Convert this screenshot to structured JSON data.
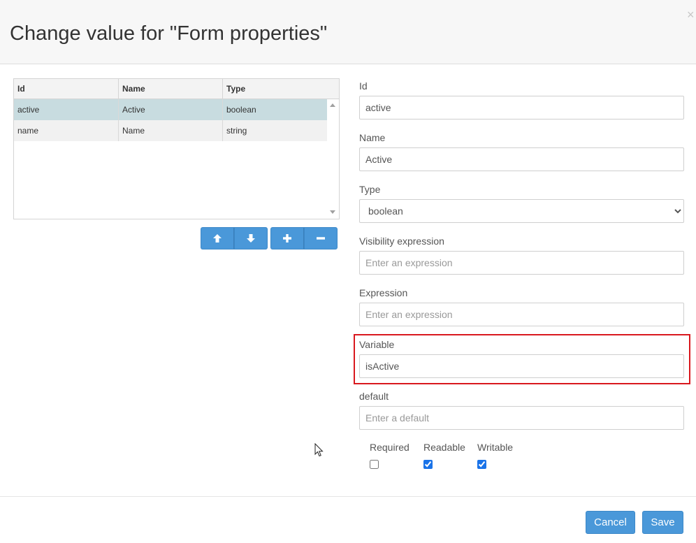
{
  "dialog": {
    "title": "Change value for \"Form properties\"",
    "close_glyph": "×"
  },
  "grid": {
    "columns": [
      "Id",
      "Name",
      "Type"
    ],
    "rows": [
      {
        "id": "active",
        "name": "Active",
        "type": "boolean",
        "selected": true
      },
      {
        "id": "name",
        "name": "Name",
        "type": "string",
        "selected": false
      }
    ]
  },
  "actions": {
    "move_up_icon": "arrow-up-icon",
    "move_down_icon": "arrow-down-icon",
    "add_icon": "plus-icon",
    "remove_icon": "minus-icon"
  },
  "form": {
    "id_label": "Id",
    "id_value": "active",
    "name_label": "Name",
    "name_value": "Active",
    "type_label": "Type",
    "type_value": "boolean",
    "visibility_label": "Visibility expression",
    "visibility_placeholder": "Enter an expression",
    "expression_label": "Expression",
    "expression_placeholder": "Enter an expression",
    "variable_label": "Variable",
    "variable_value": "isActive",
    "default_label": "default",
    "default_placeholder": "Enter a default",
    "required_label": "Required",
    "required_checked": false,
    "readable_label": "Readable",
    "readable_checked": true,
    "writable_label": "Writable",
    "writable_checked": true
  },
  "footer": {
    "cancel_label": "Cancel",
    "save_label": "Save"
  },
  "colors": {
    "primary_button": "#4a98d9",
    "selected_row": "#c8dce0",
    "highlight_border": "#d9181e"
  }
}
